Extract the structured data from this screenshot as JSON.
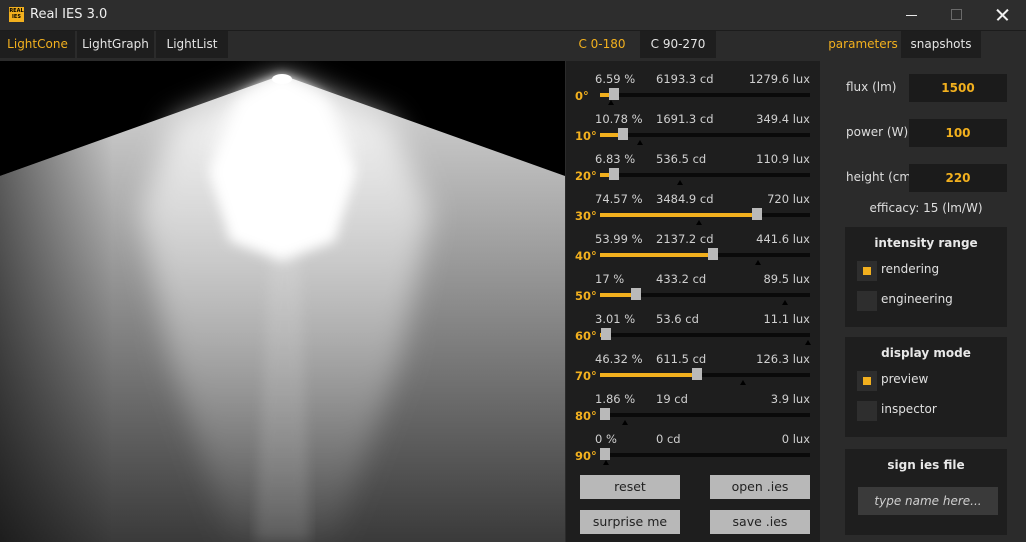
{
  "window": {
    "title": "Real IES 3.0",
    "logo_text": "REAL IES"
  },
  "view_tabs": [
    {
      "label": "LightCone",
      "active": true
    },
    {
      "label": "LightGraph",
      "active": false
    },
    {
      "label": "LightList",
      "active": false
    }
  ],
  "c_tabs": [
    {
      "label": "C 0-180",
      "active": true
    },
    {
      "label": "C 90-270",
      "active": false
    }
  ],
  "angles": [
    {
      "deg": "0°",
      "pct": "6.59 %",
      "cd": "6193.3 cd",
      "lux": "1279.6 lux",
      "fill": 0.0659,
      "marker": 0.05
    },
    {
      "deg": "10°",
      "pct": "10.78 %",
      "cd": "1691.3 cd",
      "lux": "349.4 lux",
      "fill": 0.1078,
      "marker": 0.19
    },
    {
      "deg": "20°",
      "pct": "6.83 %",
      "cd": "536.5 cd",
      "lux": "110.9 lux",
      "fill": 0.0683,
      "marker": 0.38
    },
    {
      "deg": "30°",
      "pct": "74.57 %",
      "cd": "3484.9 cd",
      "lux": "720 lux",
      "fill": 0.7457,
      "marker": 0.47
    },
    {
      "deg": "40°",
      "pct": "53.99 %",
      "cd": "2137.2 cd",
      "lux": "441.6 lux",
      "fill": 0.5399,
      "marker": 0.75
    },
    {
      "deg": "50°",
      "pct": "17 %",
      "cd": "433.2 cd",
      "lux": "89.5 lux",
      "fill": 0.17,
      "marker": 0.88
    },
    {
      "deg": "60°",
      "pct": "3.01 %",
      "cd": "53.6 cd",
      "lux": "11.1 lux",
      "fill": 0.0301,
      "marker": 0.99
    },
    {
      "deg": "70°",
      "pct": "46.32 %",
      "cd": "611.5 cd",
      "lux": "126.3 lux",
      "fill": 0.4632,
      "marker": 0.68
    },
    {
      "deg": "80°",
      "pct": "1.86 %",
      "cd": "19 cd",
      "lux": "3.9 lux",
      "fill": 0.0186,
      "marker": 0.12
    },
    {
      "deg": "90°",
      "pct": "0 %",
      "cd": "0 cd",
      "lux": "0 lux",
      "fill": 0,
      "marker": 0.03
    }
  ],
  "buttons": {
    "reset": "reset",
    "open": "open .ies",
    "surprise": "surprise me",
    "save": "save .ies"
  },
  "right_tabs": [
    {
      "label": "parameters",
      "active": true
    },
    {
      "label": "snapshots",
      "active": false
    }
  ],
  "parameters": {
    "flux_label": "flux (lm)",
    "flux_value": "1500",
    "power_label": "power (W)",
    "power_value": "100",
    "height_label": "height (cm)",
    "height_value": "220",
    "efficacy": "efficacy: 15 (lm/W)"
  },
  "intensity_range": {
    "title": "intensity range",
    "options": [
      {
        "label": "rendering",
        "checked": true
      },
      {
        "label": "engineering",
        "checked": false
      }
    ]
  },
  "display_mode": {
    "title": "display mode",
    "options": [
      {
        "label": "preview",
        "checked": true
      },
      {
        "label": "inspector",
        "checked": false
      }
    ]
  },
  "sign": {
    "title": "sign ies file",
    "placeholder": "type name here..."
  },
  "colors": {
    "accent": "#f2b01e",
    "panel": "#1e1e1e",
    "background": "#2b2b2b"
  }
}
